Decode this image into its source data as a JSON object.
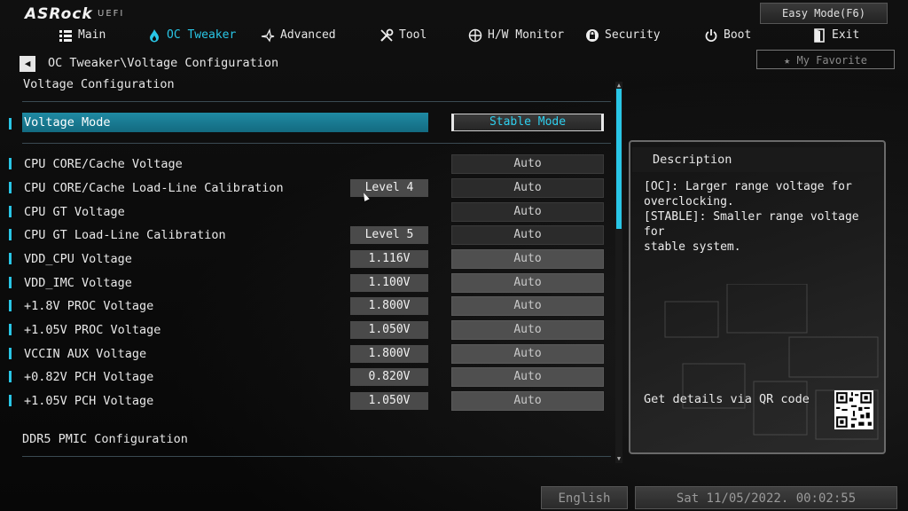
{
  "brand": {
    "logo": "ASRock",
    "sub": "UEFI"
  },
  "header": {
    "easy_mode": "Easy Mode(F6)",
    "favorite": "My Favorite"
  },
  "nav": [
    {
      "label": "Main",
      "icon": "list-icon",
      "active": false
    },
    {
      "label": "OC Tweaker",
      "icon": "flame-icon",
      "active": true
    },
    {
      "label": "Advanced",
      "icon": "star-plane-icon",
      "active": false
    },
    {
      "label": "Tool",
      "icon": "tools-icon",
      "active": false
    },
    {
      "label": "H/W Monitor",
      "icon": "crosshair-icon",
      "active": false
    },
    {
      "label": "Security",
      "icon": "shield-icon",
      "active": false
    },
    {
      "label": "Boot",
      "icon": "power-icon",
      "active": false
    },
    {
      "label": "Exit",
      "icon": "exit-icon",
      "active": false
    }
  ],
  "breadcrumb": "OC Tweaker\\Voltage Configuration",
  "page_title": "Voltage Configuration",
  "voltage_mode": {
    "label": "Voltage Mode",
    "value": "Stable Mode"
  },
  "rows": [
    {
      "label": "CPU CORE/Cache Voltage",
      "level": "",
      "value": "Auto",
      "grey": false
    },
    {
      "label": "CPU CORE/Cache Load-Line Calibration",
      "level": "Level 4",
      "value": "Auto",
      "grey": false
    },
    {
      "label": "CPU GT Voltage",
      "level": "",
      "value": "Auto",
      "grey": false
    },
    {
      "label": "CPU GT Load-Line Calibration",
      "level": "Level 5",
      "value": "Auto",
      "grey": false
    },
    {
      "label": "VDD_CPU Voltage",
      "level": "1.116V",
      "value": "Auto",
      "grey": true
    },
    {
      "label": "VDD_IMC Voltage",
      "level": "1.100V",
      "value": "Auto",
      "grey": true
    },
    {
      "label": "+1.8V PROC Voltage",
      "level": "1.800V",
      "value": "Auto",
      "grey": true
    },
    {
      "label": "+1.05V PROC Voltage",
      "level": "1.050V",
      "value": "Auto",
      "grey": true
    },
    {
      "label": "VCCIN AUX Voltage",
      "level": "1.800V",
      "value": "Auto",
      "grey": true
    },
    {
      "label": "+0.82V PCH Voltage",
      "level": "0.820V",
      "value": "Auto",
      "grey": true
    },
    {
      "label": "+1.05V PCH Voltage",
      "level": "1.050V",
      "value": "Auto",
      "grey": true
    }
  ],
  "section_ddr5": "DDR5 PMIC Configuration",
  "description": {
    "title": "Description",
    "text": "[OC]: Larger range voltage for\noverclocking.\n[STABLE]: Smaller range voltage for\nstable system.",
    "qr_label": "Get details via QR code"
  },
  "footer": {
    "language": "English",
    "datetime": "Sat 11/05/2022. 00:02:55"
  },
  "colors": {
    "accent": "#29c6e6",
    "selected_bar": "#1a7f97"
  }
}
